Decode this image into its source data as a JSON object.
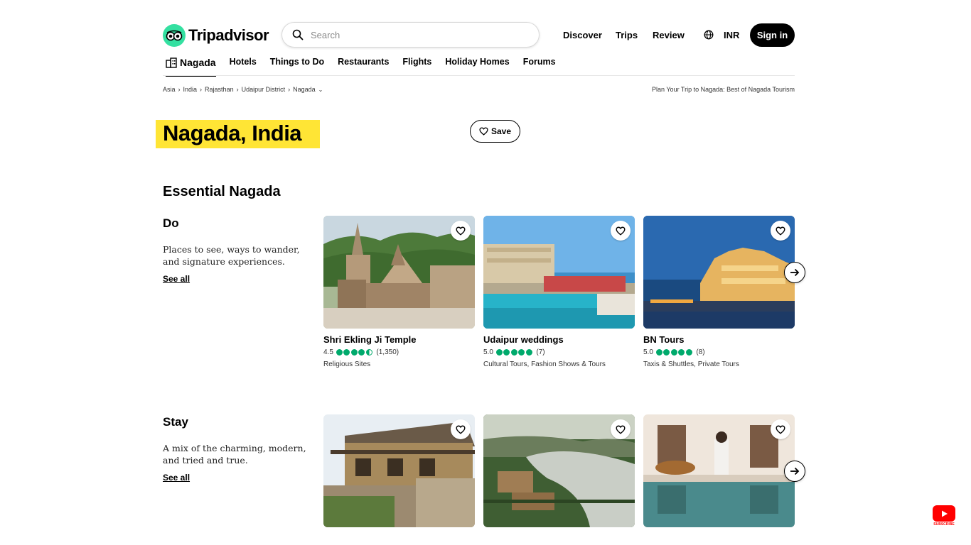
{
  "brand": {
    "name": "Tripadvisor",
    "accent": "#34e0a1"
  },
  "search": {
    "placeholder": "Search"
  },
  "top_nav": {
    "discover": "Discover",
    "trips": "Trips",
    "review": "Review",
    "currency": "INR",
    "sign_in": "Sign in"
  },
  "sub_nav": {
    "items": [
      "Nagada",
      "Hotels",
      "Things to Do",
      "Restaurants",
      "Flights",
      "Holiday Homes",
      "Forums"
    ]
  },
  "breadcrumb": {
    "items": [
      "Asia",
      "India",
      "Rajasthan",
      "Udaipur District",
      "Nagada"
    ],
    "right": "Plan Your Trip to Nagada: Best of Nagada Tourism"
  },
  "page": {
    "title": "Nagada, India",
    "save_label": "Save",
    "section_title": "Essential Nagada",
    "highlight_color": "#ffe535"
  },
  "do": {
    "title": "Do",
    "description": "Places to see, ways to wander, and signature experiences.",
    "see_all": "See all",
    "cards": [
      {
        "name": "Shri Ekling Ji Temple",
        "score": "4.5",
        "reviews": "(1,350)",
        "tags": "Religious Sites",
        "bubbles": 4.5
      },
      {
        "name": "Udaipur weddings",
        "score": "5.0",
        "reviews": "(7)",
        "tags": "Cultural Tours, Fashion Shows & Tours",
        "bubbles": 5
      },
      {
        "name": "BN Tours",
        "score": "5.0",
        "reviews": "(8)",
        "tags": "Taxis & Shuttles, Private Tours",
        "bubbles": 5
      }
    ]
  },
  "stay": {
    "title": "Stay",
    "description": "A mix of the charming, modern, and tried and true.",
    "see_all": "See all"
  },
  "youtube": {
    "label": "SUBSCRIBE"
  },
  "rating_color": "#00aa6c"
}
